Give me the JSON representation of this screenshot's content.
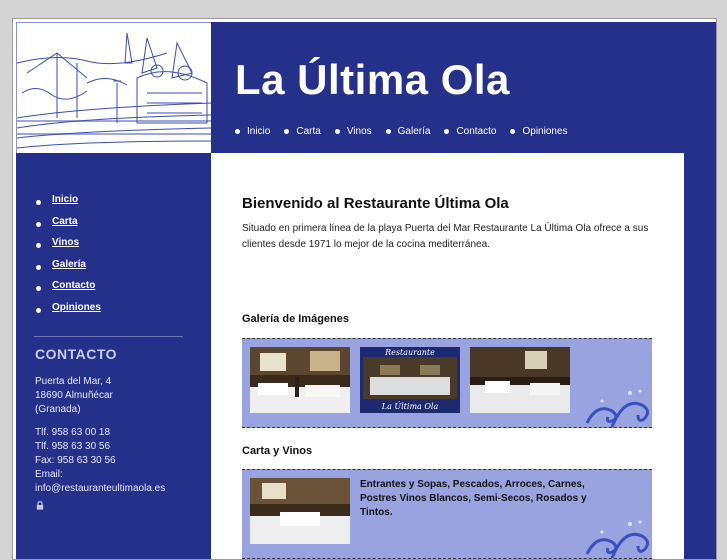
{
  "header": {
    "title": "La Última Ola",
    "nav": [
      "Inicio",
      "Carta",
      "Vinos",
      "Galería",
      "Contacto",
      "Opiniones"
    ]
  },
  "sidebar": {
    "menu": [
      "Inicio",
      "Carta",
      "Vinos",
      "Galería",
      "Contacto",
      "Opiniones"
    ],
    "contact_title": "CONTACTO",
    "address": [
      "Puerta del Mar, 4",
      "18690 Almuñécar",
      "(Granada)"
    ],
    "phones": [
      "Tlf.  958 63 00 18",
      "Tlf.  958 63 30 56",
      "Fax: 958 63 30 56",
      "Email:",
      "info@restauranteultimaola.es"
    ],
    "lock_icon": "lock-icon"
  },
  "main": {
    "welcome_title": "Bienvenido al Restaurante Última Ola",
    "welcome_text": "Situado en primera línea de la playa Puerta del Mar Restaurante La Última Ola ofrece a sus clientes desde 1971 lo mejor de la cocina mediterránea.",
    "gallery_title": "Galería de Imágenes",
    "gallery_sign_top": "Restaurante",
    "gallery_sign_bottom": "La  Última  Ola",
    "menu_title": "Carta y Vinos",
    "menu_text": "Entrantes y Sopas, Pescados, Arroces, Carnes, Postres Vinos Blancos, Semi-Secos, Rosados y Tintos."
  },
  "colors": {
    "brand_blue": "#24308a",
    "panel_blue": "#98a3e0",
    "background": "#d4d4d4"
  }
}
